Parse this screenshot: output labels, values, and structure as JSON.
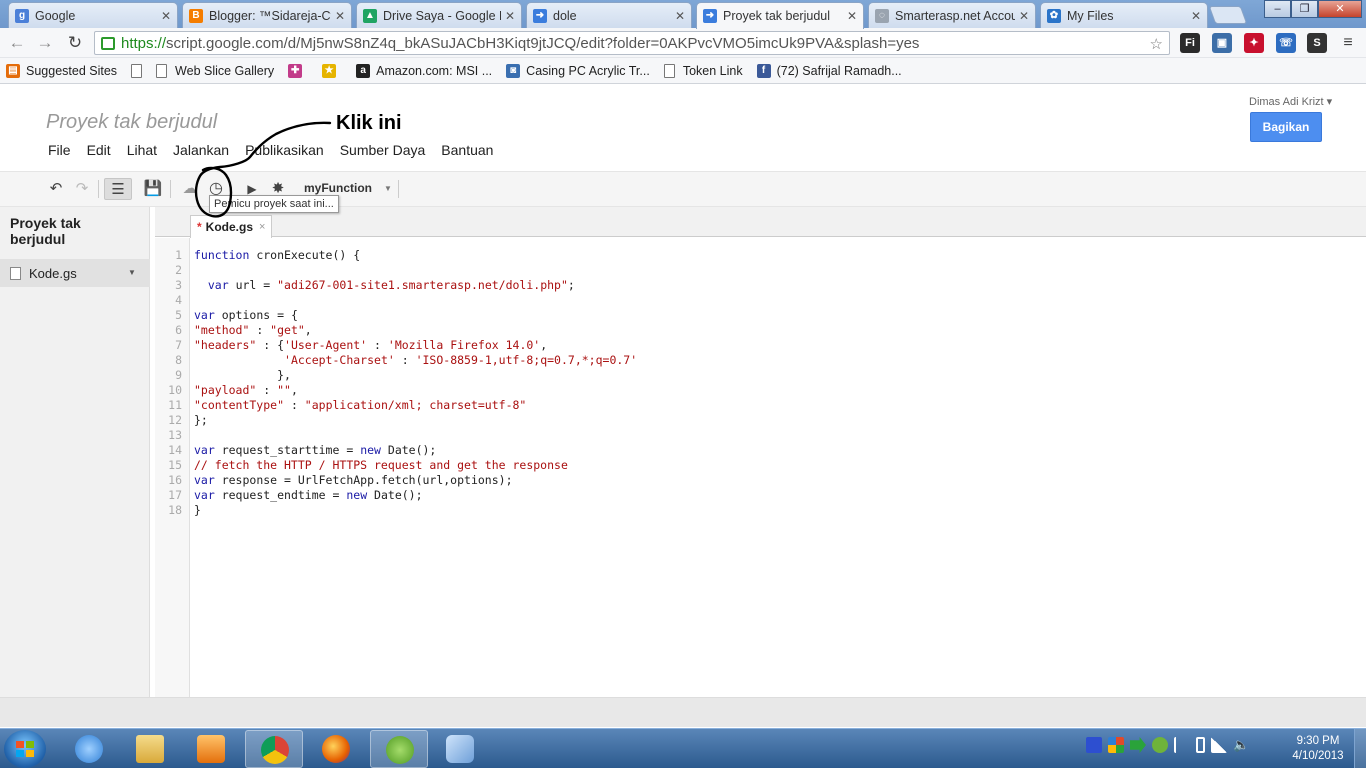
{
  "browser": {
    "tabs": [
      {
        "label": "Google",
        "favicon": "google-g-icon",
        "color": "#4a7fd8",
        "glyph": "g"
      },
      {
        "label": "Blogger: ™Sidareja-Cy",
        "favicon": "blogger-icon",
        "color": "#f57d00",
        "glyph": "B"
      },
      {
        "label": "Drive Saya - Google D",
        "favicon": "google-drive-icon",
        "color": "#1fa463",
        "glyph": "▲"
      },
      {
        "label": "dole",
        "favicon": "apps-script-arrow-icon",
        "color": "#3b7ddd",
        "glyph": "➜"
      },
      {
        "label": "Proyek tak berjudul",
        "favicon": "apps-script-arrow-icon",
        "color": "#3b7ddd",
        "glyph": "➜"
      },
      {
        "label": "Smarterasp.net Accou",
        "favicon": "loading-spinner-icon",
        "color": "#9aa4b0",
        "glyph": "◌"
      },
      {
        "label": "My Files",
        "favicon": "smarterasp-logo-icon",
        "color": "#2a74c9",
        "glyph": "✿"
      }
    ],
    "address": {
      "scheme": "https://",
      "rest": "script.google.com/d/Mj5nwS8nZ4q_bkASuJACbH3Kiqt9jtJCQ/edit?folder=0AKPvcVMO5imcUk9PVA&splash=yes"
    },
    "bookmarks": [
      {
        "label": "Suggested Sites",
        "icon": "suggested-sites-icon",
        "color": "#e46c0a"
      },
      {
        "label": "",
        "icon": "page-icon",
        "color": ""
      },
      {
        "label": "Web Slice Gallery",
        "icon": "page-icon",
        "color": ""
      },
      {
        "label": "",
        "icon": "colorful-bookmark-icon",
        "color": "#c23b8a"
      },
      {
        "label": "",
        "icon": "yellow-bookmark-icon",
        "color": "#e6b400"
      },
      {
        "label": "Amazon.com: MSI ...",
        "icon": "amazon-icon",
        "color": "#222222"
      },
      {
        "label": "Casing PC Acrylic Tr...",
        "icon": "store-icon",
        "color": "#3a6fb0"
      },
      {
        "label": "Token Link",
        "icon": "page-icon",
        "color": ""
      },
      {
        "label": "(72) Safrijal Ramadh...",
        "icon": "facebook-icon",
        "color": "#3b5998"
      }
    ]
  },
  "app": {
    "project_title": "Proyek tak berjudul",
    "menu": [
      "File",
      "Edit",
      "Lihat",
      "Jalankan",
      "Publikasikan",
      "Sumber Daya",
      "Bantuan"
    ],
    "user": "Dimas Adi Krizt",
    "user_caret": "▾",
    "share_label": "Bagikan",
    "function_select": "myFunction",
    "tooltip": "Pemicu proyek saat ini...",
    "annotation_label": "Klik ini",
    "sidebar": {
      "project_name": "Proyek tak berjudul",
      "file_name": "Kode.gs"
    },
    "file_tab": {
      "modified_marker": "*",
      "name": "Kode.gs",
      "close": "×"
    },
    "code_lines": [
      {
        "n": "1",
        "text": "function cronExecute() {"
      },
      {
        "n": "2",
        "text": ""
      },
      {
        "n": "3",
        "text": "  var url = \"adi267-001-site1.smarterasp.net/doli.php\";"
      },
      {
        "n": "4",
        "text": ""
      },
      {
        "n": "5",
        "text": "var options = {"
      },
      {
        "n": "6",
        "text": "\"method\" : \"get\","
      },
      {
        "n": "7",
        "text": "\"headers\" : {'User-Agent' : 'Mozilla Firefox 14.0',"
      },
      {
        "n": "8",
        "text": "             'Accept-Charset' : 'ISO-8859-1,utf-8;q=0.7,*;q=0.7'"
      },
      {
        "n": "9",
        "text": "            },"
      },
      {
        "n": "10",
        "text": "\"payload\" : \"\","
      },
      {
        "n": "11",
        "text": "\"contentType\" : \"application/xml; charset=utf-8\""
      },
      {
        "n": "12",
        "text": "};"
      },
      {
        "n": "13",
        "text": ""
      },
      {
        "n": "14",
        "text": "var request_starttime = new Date();"
      },
      {
        "n": "15",
        "text": "// fetch the HTTP / HTTPS request and get the response"
      },
      {
        "n": "16",
        "text": "var response = UrlFetchApp.fetch(url,options);"
      },
      {
        "n": "17",
        "text": "var request_endtime = new Date();"
      },
      {
        "n": "18",
        "text": "}"
      }
    ]
  },
  "taskbar": {
    "time": "9:30 PM",
    "date": "4/10/2013",
    "apps": [
      {
        "name": "internet-explorer-icon",
        "color": "#2f7fd6",
        "active": false
      },
      {
        "name": "windows-explorer-icon",
        "color": "#e8c25a",
        "active": false
      },
      {
        "name": "media-player-icon",
        "color": "#f08a1c",
        "active": false
      },
      {
        "name": "chrome-icon",
        "color": "#db4437",
        "active": true
      },
      {
        "name": "firefox-icon",
        "color": "#e66000",
        "active": false
      },
      {
        "name": "utorrent-icon",
        "color": "#78b83b",
        "active": false
      },
      {
        "name": "paint-icon",
        "color": "#8fb8e8",
        "active": false
      }
    ],
    "tray_icons": [
      {
        "name": "bluetooth-tray-icon",
        "color": "#2d4fd0"
      },
      {
        "name": "windows-flag-tray-icon",
        "color": "#e04a2a"
      },
      {
        "name": "green-arrow-tray-icon",
        "color": "#2aa33a"
      },
      {
        "name": "utorrent-tray-icon",
        "color": "#6fb33a"
      },
      {
        "name": "action-center-flag-icon",
        "color": "#ffffff"
      },
      {
        "name": "battery-icon",
        "color": "#ffffff"
      },
      {
        "name": "network-signal-icon",
        "color": "#ffffff"
      },
      {
        "name": "volume-icon",
        "color": "#ffffff"
      }
    ]
  }
}
